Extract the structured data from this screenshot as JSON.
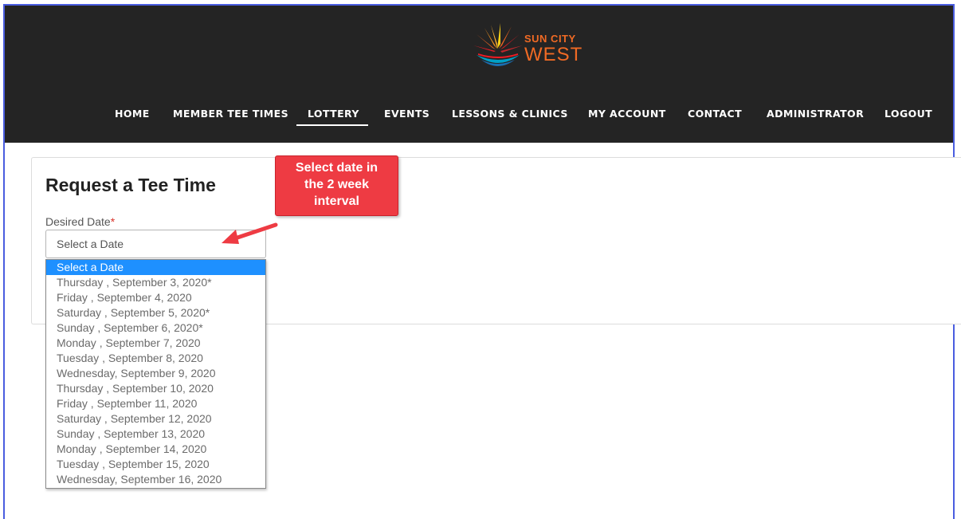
{
  "logo": {
    "line1": "SUN CITY",
    "line2": "WEST"
  },
  "nav": {
    "items": [
      {
        "label": "HOME",
        "active": false
      },
      {
        "label": "MEMBER TEE TIMES",
        "active": false
      },
      {
        "label": "LOTTERY",
        "active": true
      },
      {
        "label": "EVENTS",
        "active": false
      },
      {
        "label": "LESSONS & CLINICS",
        "active": false
      },
      {
        "label": "MY ACCOUNT",
        "active": false
      },
      {
        "label": "CONTACT",
        "active": false
      },
      {
        "label": "ADMINISTRATOR",
        "active": false
      },
      {
        "label": "LOGOUT",
        "active": false
      }
    ]
  },
  "page": {
    "title": "Request a Tee Time",
    "field_label": "Desired Date",
    "required_mark": "*"
  },
  "date_select": {
    "current_value": "Select a Date",
    "options": [
      "Select a Date",
      "Thursday , September 3, 2020*",
      "Friday , September 4, 2020",
      "Saturday , September 5, 2020*",
      "Sunday , September 6, 2020*",
      "Monday , September 7, 2020",
      "Tuesday , September 8, 2020",
      "Wednesday, September 9, 2020",
      "Thursday , September 10, 2020",
      "Friday , September 11, 2020",
      "Saturday , September 12, 2020",
      "Sunday , September 13, 2020",
      "Monday , September 14, 2020",
      "Tuesday , September 15, 2020",
      "Wednesday, September 16, 2020"
    ],
    "highlighted_index": 0
  },
  "annotation": {
    "lines": [
      "Select date in",
      "the 2 week",
      "interval"
    ]
  },
  "colors": {
    "header_bg": "#242424",
    "accent_orange": "#f06a24",
    "highlight_blue": "#1e90ff",
    "callout_red": "#ee3b43",
    "frame_blue": "#4a5de0"
  }
}
